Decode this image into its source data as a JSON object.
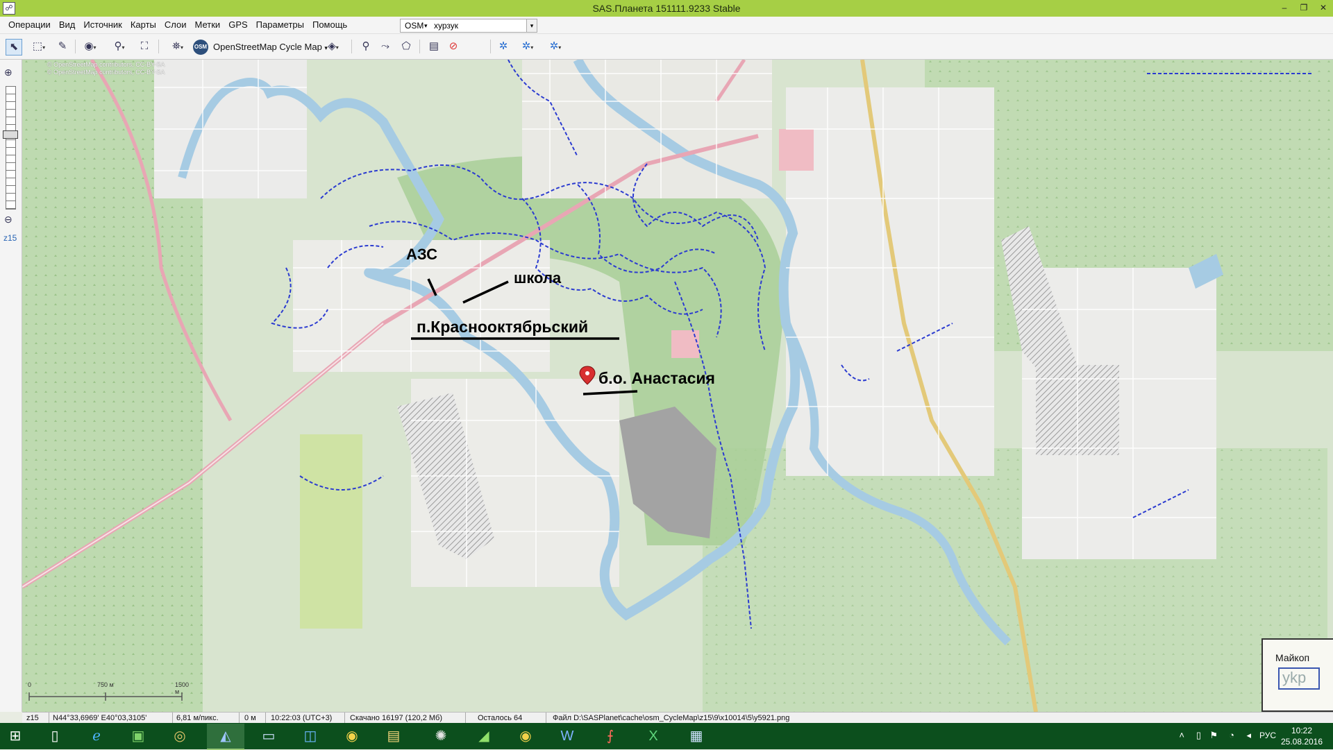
{
  "window": {
    "title": "SAS.Планета 151111.9233 Stable",
    "min_glyph": "–",
    "max_glyph": "❐",
    "close_glyph": "✕"
  },
  "menu": {
    "items": [
      "Операции",
      "Вид",
      "Источник",
      "Карты",
      "Слои",
      "Метки",
      "GPS",
      "Параметры",
      "Помощь"
    ],
    "map_type": "OSM",
    "search_value": "хурзук"
  },
  "toolbar": {
    "layer_label": "OpenStreetMap Cycle Map",
    "osm_badge": "OSM"
  },
  "side": {
    "zoom_level": "z15"
  },
  "map": {
    "copyright_lines": [
      "© OpenStreetMap contributors, CC-BY-SA",
      "© OpenStreetMap contributors, CC-BY-SA"
    ],
    "annotations": {
      "azs": "АЗС",
      "school": "школа",
      "village": "п.Краснооктябрьский",
      "base": "б.о. Анастасия"
    },
    "scale": {
      "zero": "0",
      "mid": "750 м",
      "end": "1500 м"
    },
    "minimap": {
      "label": "Майкоп",
      "text": "ykp"
    },
    "marker": "map-marker"
  },
  "status": {
    "zoom": "z15",
    "coords": "N44°33,6969' E40°03,3105'",
    "resolution": "6,81 м/пикс.",
    "elevation": "0 м",
    "time": "10:22:03 (UTC+3)",
    "downloaded": "Скачано 16197 (120,2 Мб)",
    "remaining": "Осталось 64",
    "file": "Файл D:\\SASPlanet\\cache\\osm_CycleMap\\z15\\9\\x10014\\5\\y5921.png"
  },
  "taskbar": {
    "apps": [
      "start",
      "file",
      "internet-explorer",
      "store",
      "media",
      "sas-planet",
      "desktop",
      "remote",
      "chrome",
      "explorer",
      "network",
      "maps",
      "chrome-2",
      "word",
      "pdf",
      "excel",
      "window"
    ],
    "lang": "РУС",
    "time": "10:22",
    "date": "25.08.2016"
  },
  "colors": {
    "title_bar": "#a6cf45",
    "taskbar": "#0c4f1d",
    "water": "#a6cbe3",
    "forest": "#b7d7a8",
    "trail": "#2b3bd0",
    "road": "#e8a6b4"
  }
}
